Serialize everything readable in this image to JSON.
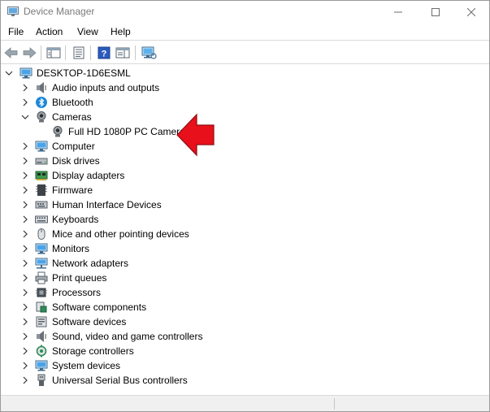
{
  "window": {
    "title": "Device Manager",
    "minimize_icon": "minimize-icon",
    "maximize_icon": "maximize-icon",
    "close_icon": "close-icon"
  },
  "menu": [
    "File",
    "Action",
    "View",
    "Help"
  ],
  "toolbar": [
    "back-arrow-icon",
    "forward-arrow-icon",
    "show-hide-console-tree-icon",
    "properties-icon",
    "help-icon",
    "action-pane-icon",
    "scan-hardware-icon"
  ],
  "tree": {
    "root": "DESKTOP-1D6ESML",
    "categories": [
      {
        "label": "Audio inputs and outputs",
        "icon": "speaker-icon",
        "expanded": false
      },
      {
        "label": "Bluetooth",
        "icon": "bluetooth-icon",
        "expanded": false
      },
      {
        "label": "Cameras",
        "icon": "camera-icon",
        "expanded": true,
        "children": [
          {
            "label": "Full HD 1080P PC Camera",
            "icon": "camera-icon"
          }
        ]
      },
      {
        "label": "Computer",
        "icon": "computer-icon",
        "expanded": false
      },
      {
        "label": "Disk drives",
        "icon": "disk-drive-icon",
        "expanded": false
      },
      {
        "label": "Display adapters",
        "icon": "display-adapter-icon",
        "expanded": false
      },
      {
        "label": "Firmware",
        "icon": "firmware-icon",
        "expanded": false
      },
      {
        "label": "Human Interface Devices",
        "icon": "hid-icon",
        "expanded": false
      },
      {
        "label": "Keyboards",
        "icon": "keyboard-icon",
        "expanded": false
      },
      {
        "label": "Mice and other pointing devices",
        "icon": "mouse-icon",
        "expanded": false
      },
      {
        "label": "Monitors",
        "icon": "monitor-icon",
        "expanded": false
      },
      {
        "label": "Network adapters",
        "icon": "network-adapter-icon",
        "expanded": false
      },
      {
        "label": "Print queues",
        "icon": "printer-icon",
        "expanded": false
      },
      {
        "label": "Processors",
        "icon": "processor-icon",
        "expanded": false
      },
      {
        "label": "Software components",
        "icon": "software-component-icon",
        "expanded": false
      },
      {
        "label": "Software devices",
        "icon": "software-device-icon",
        "expanded": false
      },
      {
        "label": "Sound, video and game controllers",
        "icon": "sound-controller-icon",
        "expanded": false
      },
      {
        "label": "Storage controllers",
        "icon": "storage-controller-icon",
        "expanded": false
      },
      {
        "label": "System devices",
        "icon": "system-device-icon",
        "expanded": false
      },
      {
        "label": "Universal Serial Bus controllers",
        "icon": "usb-icon",
        "expanded": false
      }
    ]
  },
  "annotation": {
    "icon": "red-arrow-pointer-icon",
    "color": "#e8101a"
  },
  "colors": {
    "icon_blue": "#1e88d8",
    "title_text": "#7a7a7a",
    "accent_green": "#2e8b57"
  }
}
